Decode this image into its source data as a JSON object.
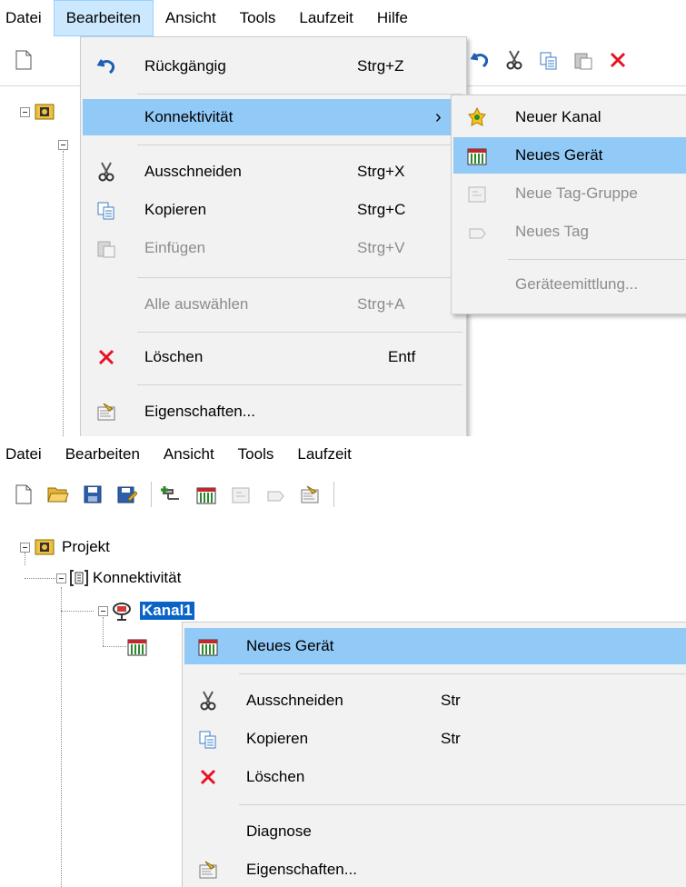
{
  "top": {
    "menubar": [
      "Datei",
      "Bearbeiten",
      "Ansicht",
      "Tools",
      "Laufzeit",
      "Hilfe"
    ],
    "edit_menu": {
      "undo": {
        "label": "Rückgängig",
        "shortcut": "Strg+Z"
      },
      "connectivity": {
        "label": "Konnektivität",
        "arrow": "›"
      },
      "cut": {
        "label": "Ausschneiden",
        "shortcut": "Strg+X"
      },
      "copy": {
        "label": "Kopieren",
        "shortcut": "Strg+C"
      },
      "paste": {
        "label": "Einfügen",
        "shortcut": "Strg+V"
      },
      "select_all": {
        "label": "Alle auswählen",
        "shortcut": "Strg+A"
      },
      "delete": {
        "label": "Löschen",
        "shortcut": "Entf"
      },
      "properties": {
        "label": "Eigenschaften..."
      }
    },
    "connectivity_submenu": {
      "new_channel": "Neuer Kanal",
      "new_device": "Neues Gerät",
      "new_tag_group": "Neue Tag-Gruppe",
      "new_tag": "Neues Tag",
      "device_discovery": "Geräteemittlung..."
    }
  },
  "bottom": {
    "menubar": [
      "Datei",
      "Bearbeiten",
      "Ansicht",
      "Tools",
      "Laufzeit"
    ],
    "tree": {
      "project": "Projekt",
      "connectivity": "Konnektivität",
      "channel": "Kanal1"
    },
    "context_menu": {
      "new_device": "Neues Gerät",
      "cut": {
        "label": "Ausschneiden",
        "shortcut": "Str"
      },
      "copy": {
        "label": "Kopieren",
        "shortcut": "Str"
      },
      "delete": "Löschen",
      "diagnostics": "Diagnose",
      "properties": "Eigenschaften..."
    }
  },
  "colors": {
    "highlight": "#91c9f7",
    "selection": "#0a64c8",
    "delete_red": "#e81123"
  }
}
